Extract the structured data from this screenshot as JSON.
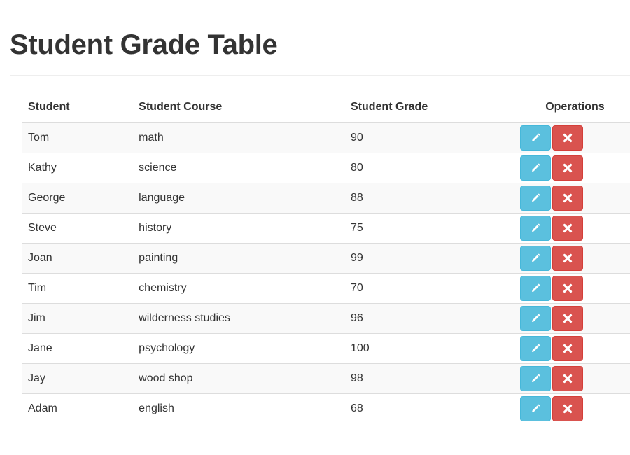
{
  "page": {
    "title": "Student Grade Table"
  },
  "table": {
    "headers": {
      "student": "Student",
      "course": "Student Course",
      "grade": "Student Grade",
      "operations": "Operations"
    },
    "rows": [
      {
        "student": "Tom",
        "course": "math",
        "grade": "90"
      },
      {
        "student": "Kathy",
        "course": "science",
        "grade": "80"
      },
      {
        "student": "George",
        "course": "language",
        "grade": "88"
      },
      {
        "student": "Steve",
        "course": "history",
        "grade": "75"
      },
      {
        "student": "Joan",
        "course": "painting",
        "grade": "99"
      },
      {
        "student": "Tim",
        "course": "chemistry",
        "grade": "70"
      },
      {
        "student": "Jim",
        "course": "wilderness studies",
        "grade": "96"
      },
      {
        "student": "Jane",
        "course": "psychology",
        "grade": "100"
      },
      {
        "student": "Jay",
        "course": "wood shop",
        "grade": "98"
      },
      {
        "student": "Adam",
        "course": "english",
        "grade": "68"
      }
    ],
    "row_actions": {
      "edit_icon": "pencil-icon",
      "delete_icon": "close-icon"
    }
  },
  "colors": {
    "edit_button": "#5bc0de",
    "delete_button": "#d9534f",
    "stripe": "#f9f9f9"
  }
}
